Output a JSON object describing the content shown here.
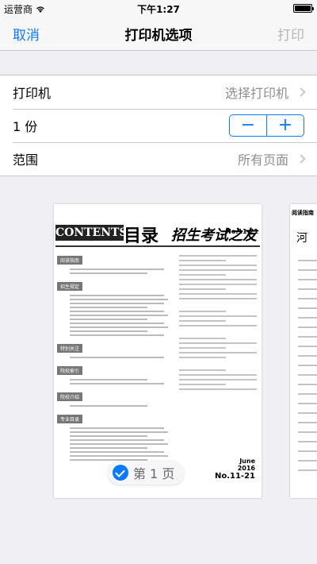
{
  "status": {
    "carrier": "运营商",
    "time": "下午1:27"
  },
  "nav": {
    "cancel": "取消",
    "title": "打印机选项",
    "print": "打印"
  },
  "rows": {
    "printer": {
      "label": "打印机",
      "value": "选择打印机"
    },
    "copies": {
      "label": "1 份",
      "minus": "−",
      "plus": "+"
    },
    "range": {
      "label": "范围",
      "value": "所有页面"
    }
  },
  "preview": {
    "badge": "第 1 页",
    "page1": {
      "contents": "CONTENTS",
      "mulu": "目录",
      "magazine": "招生考试之友",
      "issue": "No.11-21",
      "sections": [
        "阅读指南",
        "招生规定",
        "特别关注",
        "院校索引",
        "院校介绍",
        "专业目录"
      ],
      "month": "June",
      "year": "2016",
      "no": "No.11-21"
    },
    "page2": {
      "tag": "阅读指南",
      "char": "河"
    }
  },
  "colors": {
    "accent": "#0a7aff",
    "background": "#efeff4"
  }
}
